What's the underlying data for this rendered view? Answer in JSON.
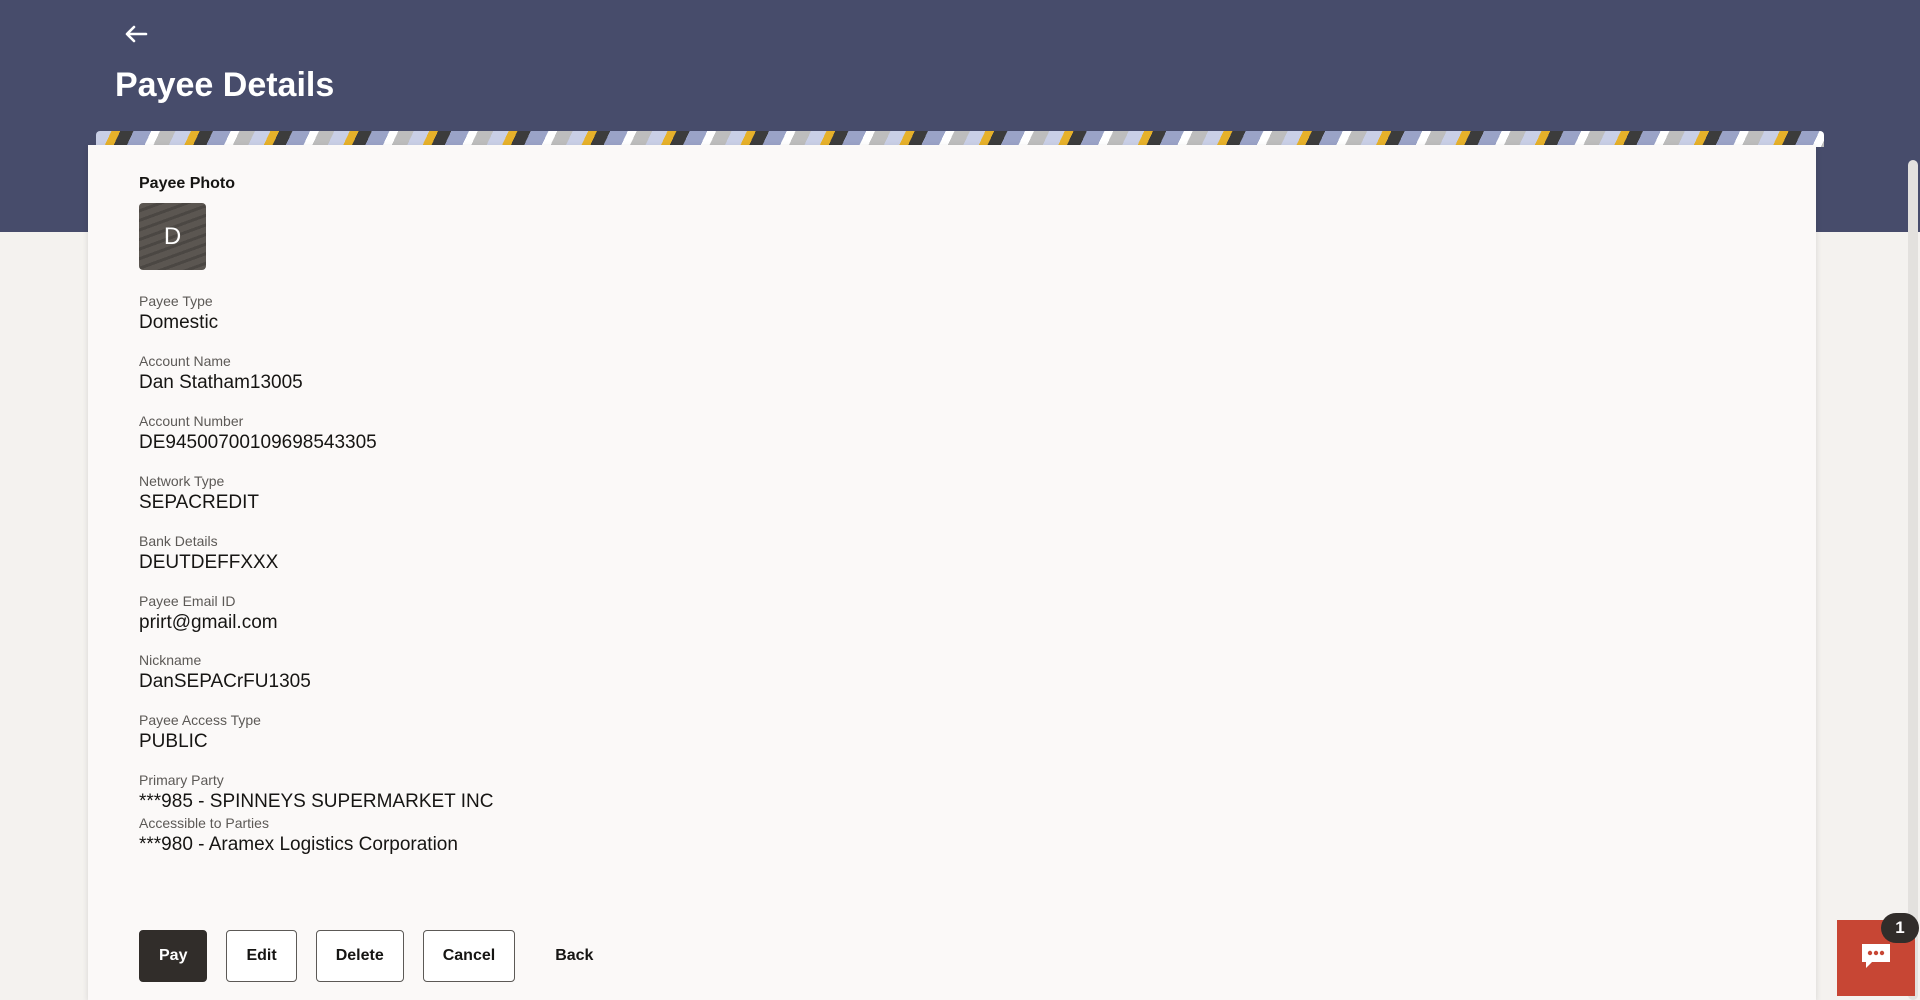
{
  "header": {
    "title": "Payee Details",
    "back_icon": "arrow-left-icon"
  },
  "payee": {
    "photo_label": "Payee Photo",
    "avatar_initial": "D",
    "fields": [
      {
        "label": "Payee Type",
        "value": "Domestic"
      },
      {
        "label": "Account Name",
        "value": "Dan Statham13005"
      },
      {
        "label": "Account Number",
        "value": "DE94500700109698543305"
      },
      {
        "label": "Network Type",
        "value": "SEPACREDIT"
      },
      {
        "label": "Bank Details",
        "value": "DEUTDEFFXXX"
      },
      {
        "label": "Payee Email ID",
        "value": "prirt@gmail.com"
      },
      {
        "label": "Nickname",
        "value": "DanSEPACrFU1305"
      },
      {
        "label": "Payee Access Type",
        "value": "PUBLIC"
      },
      {
        "label": "Primary Party",
        "value": "***985 - SPINNEYS SUPERMARKET INC"
      },
      {
        "label": "Accessible to Parties",
        "value": "***980 - Aramex Logistics Corporation"
      }
    ]
  },
  "actions": {
    "pay": "Pay",
    "edit": "Edit",
    "delete": "Delete",
    "cancel": "Cancel",
    "back": "Back"
  },
  "chat": {
    "icon": "chat-icon",
    "badge_count": "1"
  },
  "colors": {
    "header_bg": "#474c6b",
    "primary_button": "#312d2a",
    "chat_bg": "#c74634"
  }
}
